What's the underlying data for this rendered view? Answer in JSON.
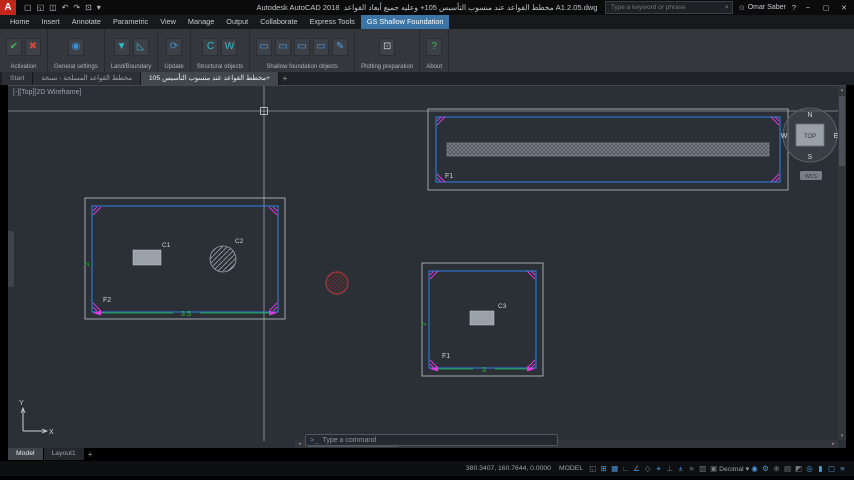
{
  "colors": {
    "accent_blue": "#2f7bd9",
    "magenta": "#e23ae2",
    "dim_green": "#27c427",
    "entity_gray": "#9aa1a8",
    "red_entity": "#93373a",
    "active_tab_blue": "#3c74a6"
  },
  "titlebar": {
    "logo_letter": "A",
    "qat": [
      {
        "name": "new",
        "glyph": "▢"
      },
      {
        "name": "open",
        "glyph": "◱"
      },
      {
        "name": "save",
        "glyph": "◫"
      },
      {
        "name": "undo",
        "glyph": "↶"
      },
      {
        "name": "redo",
        "glyph": "↷"
      },
      {
        "name": "plot",
        "glyph": "⊡"
      },
      {
        "name": "dropdown",
        "glyph": "▾"
      }
    ],
    "app_title": "Autodesk AutoCAD 2018",
    "doc_title": "مخطط القواعد عند منسوب التأسيس 105+ وعليه جميع أبعاد القواعد A1.2.05.dwg",
    "search_icon": "⌕",
    "search_placeholder": "Type a keyword or phrase",
    "user_icon": "⊙",
    "user_name": "Omar Saber",
    "help_label": "?",
    "window_controls": {
      "minimize": "‒",
      "maximize": "▢",
      "close": "✕"
    }
  },
  "ribbon": {
    "tabs": [
      {
        "label": "Home"
      },
      {
        "label": "Insert"
      },
      {
        "label": "Annotate"
      },
      {
        "label": "Parametric"
      },
      {
        "label": "View"
      },
      {
        "label": "Manage"
      },
      {
        "label": "Output"
      },
      {
        "label": "Collaborate"
      },
      {
        "label": "Express Tools"
      },
      {
        "label": "GS Shallow Foundation",
        "active": true
      }
    ],
    "groups": [
      {
        "label": "Activation",
        "buttons": [
          {
            "name": "activate",
            "glyph": "✔",
            "color": "#44b84e"
          },
          {
            "name": "deactivate",
            "glyph": "✖",
            "color": "#d4473a"
          }
        ]
      },
      {
        "label": "General settings",
        "buttons": [
          {
            "name": "general-settings",
            "glyph": "◉",
            "color": "#3f8fd6"
          }
        ]
      },
      {
        "label": "Land/Boundary",
        "buttons": [
          {
            "name": "land",
            "glyph": "▼",
            "color": "#35b8c9"
          },
          {
            "name": "boundary",
            "glyph": "◺",
            "color": "#35b8c9"
          }
        ]
      },
      {
        "label": "Update",
        "buttons": [
          {
            "name": "update",
            "glyph": "⟳",
            "color": "#3f8fd6"
          }
        ]
      },
      {
        "label": "Structural objects",
        "buttons": [
          {
            "name": "columns",
            "glyph": "C",
            "color": "#35b8c9"
          },
          {
            "name": "walls",
            "glyph": "W",
            "color": "#35b8c9"
          }
        ]
      },
      {
        "label": "Shallow foundation objects",
        "buttons": [
          {
            "name": "isolated-footing",
            "glyph": "▭",
            "color": "#4f9be0"
          },
          {
            "name": "combined-footing",
            "glyph": "▭",
            "color": "#4f9be0"
          },
          {
            "name": "strip-footing",
            "glyph": "▭",
            "color": "#4f9be0"
          },
          {
            "name": "mat-footing",
            "glyph": "▭",
            "color": "#4f9be0"
          },
          {
            "name": "edit-footing",
            "glyph": "✎",
            "color": "#4f9be0"
          }
        ]
      },
      {
        "label": "Plotting preparation",
        "buttons": [
          {
            "name": "plotting",
            "glyph": "⊡",
            "color": "#c8cdd2"
          }
        ]
      },
      {
        "label": "About",
        "buttons": [
          {
            "name": "about",
            "glyph": "?",
            "color": "#44b84e"
          }
        ]
      }
    ]
  },
  "file_tabs": {
    "tabs": [
      {
        "label": "Start"
      },
      {
        "label": "مخطط القواعد المسلحة - نسخة"
      },
      {
        "label": "مخطط القواعد عند منسوب التأسيس 105+",
        "active": true
      }
    ],
    "new_tab": "+"
  },
  "viewport": {
    "view_controls": "[-][Top][2D Wireframe]",
    "command_icon": ">_",
    "command_placeholder": "Type a command",
    "viewcube": {
      "north": "N",
      "south": "S",
      "east": "E",
      "west": "W",
      "top": "TOP",
      "wcs": "WCS"
    },
    "ucs": {
      "x": "X",
      "y": "Y"
    },
    "entities": {
      "strip_footing_label": "F1",
      "footing2_label": "F2",
      "column1_label": "C1",
      "column2_label": "C2",
      "column3_label": "C3",
      "footing1_label": "F1",
      "footing2_width_dim": "3.5",
      "footing2_height_dim": "2",
      "footing1_width_dim": "3",
      "footing1_height_dim": "2"
    },
    "scroll": {
      "left": "◂",
      "right": "▸",
      "up": "▴",
      "down": "▾"
    }
  },
  "layout_tabs": {
    "tabs": [
      {
        "label": "Model",
        "active": true
      },
      {
        "label": "Layout1"
      }
    ],
    "new_tab": "+"
  },
  "statusbar": {
    "coords": "380.3407, 160.7644, 0.0000",
    "space_label": "MODEL",
    "icons_left": [
      {
        "name": "infer-constraints",
        "glyph": "◱",
        "on": false
      },
      {
        "name": "snap-mode",
        "glyph": "⊞",
        "on": true
      },
      {
        "name": "grid-display",
        "glyph": "▦",
        "on": true
      },
      {
        "name": "ortho-mode",
        "glyph": "∟",
        "on": false
      },
      {
        "name": "polar-tracking",
        "glyph": "∠",
        "on": true
      },
      {
        "name": "isometric-drafting",
        "glyph": "◇",
        "on": false
      },
      {
        "name": "object-snap-tracking",
        "glyph": "⌖",
        "on": true
      },
      {
        "name": "dynamic-ucs",
        "glyph": "⊥",
        "on": false
      },
      {
        "name": "dynamic-input",
        "glyph": "±",
        "on": true
      },
      {
        "name": "lineweight",
        "glyph": "≡",
        "on": false
      },
      {
        "name": "transparency",
        "glyph": "▨",
        "on": false
      },
      {
        "name": "selection-cycling",
        "glyph": "▣",
        "on": false
      }
    ],
    "units_label": "Decimal",
    "units_caret": "▾",
    "icons_right": [
      {
        "name": "annotation-visibility",
        "glyph": "◉",
        "on": true
      },
      {
        "name": "workspace-switching",
        "glyph": "⚙",
        "on": true
      },
      {
        "name": "annotation-monitor",
        "glyph": "⊕",
        "on": false
      },
      {
        "name": "quick-properties",
        "glyph": "▤",
        "on": false
      },
      {
        "name": "lock-ui",
        "glyph": "◩",
        "on": false
      },
      {
        "name": "isolate-objects",
        "glyph": "◎",
        "on": true
      },
      {
        "name": "graphics-performance",
        "glyph": "▮",
        "on": true
      },
      {
        "name": "clean-screen",
        "glyph": "▢",
        "on": true
      },
      {
        "name": "customize",
        "glyph": "≡",
        "on": true
      }
    ]
  }
}
